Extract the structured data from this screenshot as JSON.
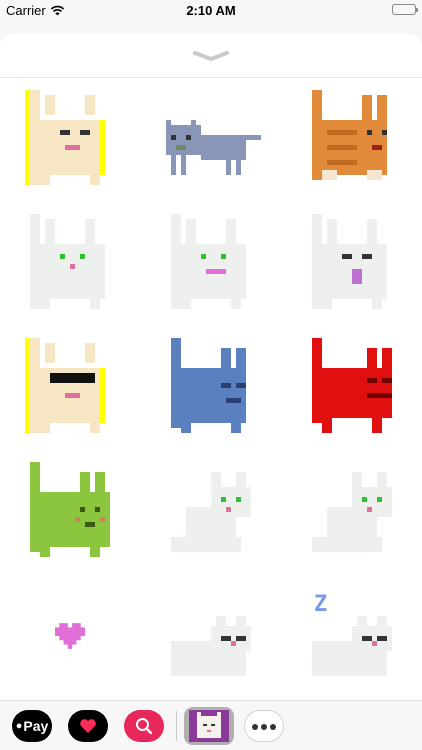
{
  "status_bar": {
    "carrier": "Carrier",
    "time": "2:10 AM",
    "wifi_icon": "wifi-icon",
    "battery_icon": "battery-icon"
  },
  "sheet": {
    "grabber_icon": "chevron-down-icon"
  },
  "stickers": [
    {
      "name": "cream-cat-happy",
      "color": "#f7e6c4"
    },
    {
      "name": "gray-cat-walking",
      "color": "#8a96b8"
    },
    {
      "name": "orange-tabby-cat",
      "color": "#e08a3a"
    },
    {
      "name": "white-cat-standing",
      "color": "#eef0ee"
    },
    {
      "name": "white-cat-smiling",
      "color": "#eef0ee"
    },
    {
      "name": "white-cat-tongue",
      "color": "#eef0ee"
    },
    {
      "name": "cream-cat-sunglasses",
      "color": "#f7e6c4"
    },
    {
      "name": "blue-cat-sad",
      "color": "#5a80c0"
    },
    {
      "name": "red-cat-angry",
      "color": "#e01010"
    },
    {
      "name": "green-cat-sick",
      "color": "#8cc63f"
    },
    {
      "name": "white-cat-sitting",
      "color": "#eef0ee"
    },
    {
      "name": "white-cat-sitting-2",
      "color": "#eef0ee"
    },
    {
      "name": "pink-heart",
      "color": "#e070d8"
    },
    {
      "name": "white-cat-sleeping",
      "color": "#eef0ee"
    },
    {
      "name": "white-cat-sleeping-z",
      "color": "#eef0ee"
    }
  ],
  "sleep_letter": "Z",
  "app_drawer": {
    "apple_pay_label": "Pay",
    "apple_pay_icon": "apple-icon",
    "heart_app_icon": "heart-icon",
    "search_app_icon": "globe-search-icon",
    "cats_app_icon": "cat-app-icon",
    "more_icon": "more-icon"
  }
}
